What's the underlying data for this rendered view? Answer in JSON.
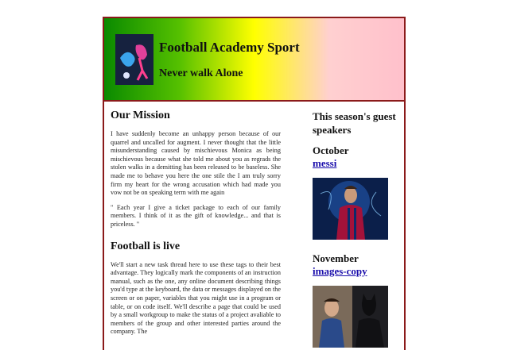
{
  "header": {
    "title": "Football Academy Sport",
    "tagline": "Never walk Alone"
  },
  "main": {
    "mission_heading": "Our Mission",
    "mission_p1": "I have suddenly become an unhappy person because of our quarrel and uncalled for augment. I never thought that the little misunderstanding caused by mischievous Monica as being mischievous because what she told me about you as regrads the stolen walks in a demitting has been released to be baseless. She made me to behave you here the one stile the I am truly sorry firm my heart for the wrong accusation which had made you vow not be on speaking term with me again",
    "mission_p2": "\" Each year I give a ticket package to each of our family members. I think of it as the gift of knowledge... and that is priceless. \"",
    "live_heading": "Football is live",
    "live_p1": "We'll start a new task thread here to use these tags to their best advantage. They logically mark the components of an instruction manual, such as the one, any online document describing things you'd type at the keyboard, the data or messages displayed on the screen or on paper, variables that you might use in a program or table, or on code itself. We'll describe a page that could be used by a small workgroup to make the status of a project avaliable to members of the group and other interested parties around the company. The"
  },
  "aside": {
    "heading": "This season's guest speakers",
    "speakers": [
      {
        "month": "October",
        "link": "messi",
        "image": "messi-photo"
      },
      {
        "month": "November",
        "link": "images-copy",
        "image": "superheroes-photo"
      }
    ]
  },
  "colors": {
    "border": "#8b1a1a",
    "header_gradient": [
      "#0a8a00",
      "#ffff00",
      "#ffc0cb"
    ],
    "link": "#1a0dab"
  }
}
